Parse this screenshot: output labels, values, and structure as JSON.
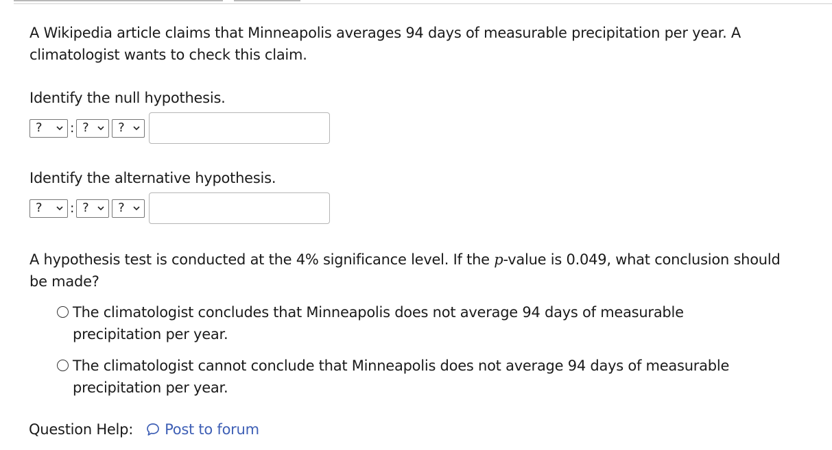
{
  "question": {
    "intro": "A Wikipedia article claims that Minneapolis averages 94 days of measurable precipitation per year. A climatologist wants to check this claim.",
    "null_label": "Identify the null hypothesis.",
    "alt_label": "Identify the alternative hypothesis.",
    "null_hypothesis": {
      "param_value": "?",
      "relation_value": "?",
      "symbol_value": "?",
      "separator": ":",
      "input_value": ""
    },
    "alt_hypothesis": {
      "param_value": "?",
      "relation_value": "?",
      "symbol_value": "?",
      "separator": ":",
      "input_value": ""
    },
    "test_prefix": "A hypothesis test is conducted at the 4% significance level. If the ",
    "test_var": "p",
    "test_suffix": "-value is 0.049, what conclusion should be made?",
    "options": [
      "The climatologist concludes that Minneapolis does not average 94 days of measurable precipitation per year.",
      "The climatologist cannot conclude that Minneapolis does not average 94 days of measurable precipitation per year."
    ]
  },
  "help": {
    "label": "Question Help:",
    "forum_link": "Post to forum",
    "forum_icon": "speech-bubble-icon"
  },
  "colors": {
    "link": "#3e5fb5",
    "text": "#1a1a1a",
    "border": "#767676"
  }
}
